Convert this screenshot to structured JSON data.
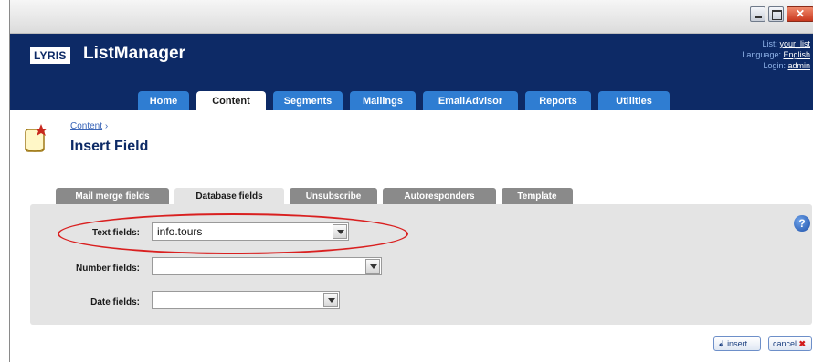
{
  "window": {
    "minimize_glyph": "",
    "maximize_glyph": "",
    "close_glyph": "✕"
  },
  "header": {
    "logo": "LYRIS",
    "app_title": "ListManager",
    "list_label": "List:",
    "list_value": "your_list",
    "language_label": "Language:",
    "language_value": "English",
    "login_label": "Login:",
    "login_value": "admin"
  },
  "nav": {
    "tabs": [
      {
        "label": "Home"
      },
      {
        "label": "Content"
      },
      {
        "label": "Segments"
      },
      {
        "label": "Mailings"
      },
      {
        "label": "EmailAdvisor"
      },
      {
        "label": "Reports"
      },
      {
        "label": "Utilities"
      }
    ],
    "active": "Content"
  },
  "breadcrumb": {
    "parent": "Content",
    "separator": "›"
  },
  "page_title": "Insert Field",
  "subtabs": [
    {
      "label": "Mail merge fields"
    },
    {
      "label": "Database fields"
    },
    {
      "label": "Unsubscribe"
    },
    {
      "label": "Autoresponders"
    },
    {
      "label": "Template"
    }
  ],
  "active_subtab": "Database fields",
  "form": {
    "text_label": "Text fields:",
    "text_value": "info.tours",
    "number_label": "Number fields:",
    "number_value": "",
    "date_label": "Date fields:",
    "date_value": ""
  },
  "help_glyph": "?",
  "buttons": {
    "insert_icon": "↲",
    "insert_label": "insert",
    "cancel_label": "cancel",
    "cancel_icon": "✖"
  },
  "colors": {
    "header_bg": "#0d2a66",
    "nav_tab": "#2f7dd2",
    "highlight": "#d92020"
  }
}
